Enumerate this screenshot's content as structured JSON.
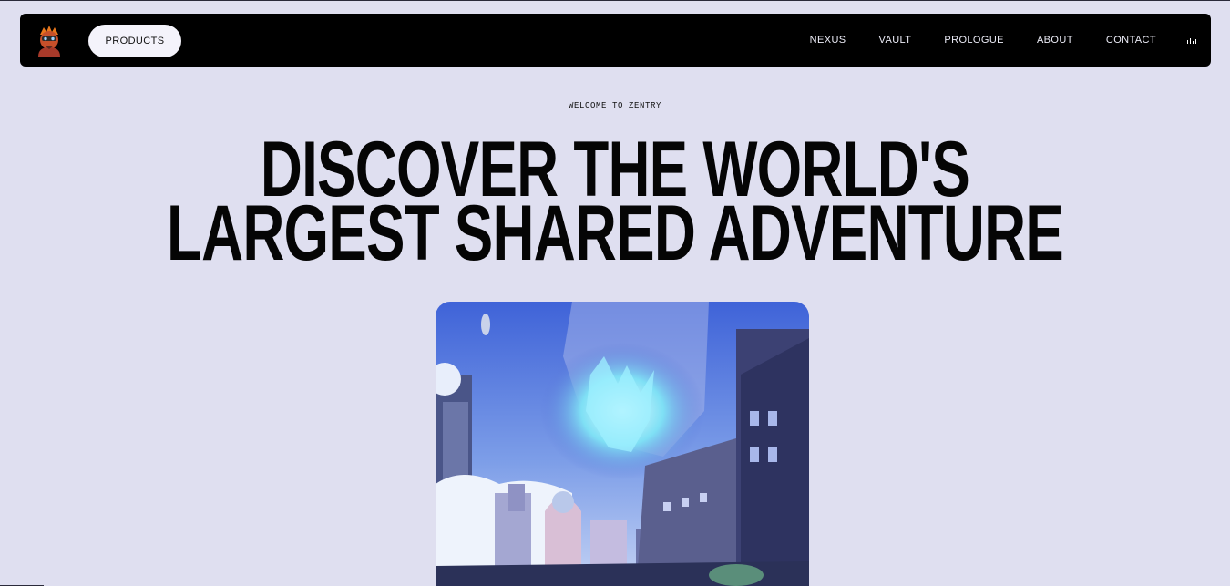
{
  "nav": {
    "products_label": "PRODUCTS",
    "links": [
      "NEXUS",
      "VAULT",
      "PROLOGUE",
      "ABOUT",
      "CONTACT"
    ],
    "logo_icon": "character-avatar-icon",
    "audio_icon": "audio-bars-icon"
  },
  "hero": {
    "eyebrow": "WELCOME TO ZENTRY",
    "headline_line1": "DISCOVER THE WORLD'S",
    "headline_line2": "LARGEST SHARED ADVENTURE",
    "image_icon": "fantasy-city-artwork"
  },
  "colors": {
    "background": "#dfdff0",
    "navbar": "#000000",
    "button": "#f4f3fb",
    "headline": "#050505"
  }
}
